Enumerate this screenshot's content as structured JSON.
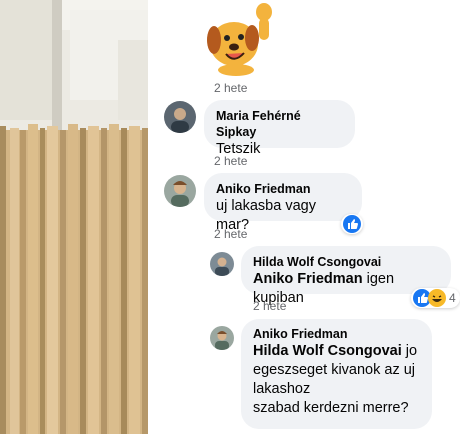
{
  "sticker": {
    "icon": "waving-dog-sticker-icon",
    "time": "2 hete"
  },
  "comments": [
    {
      "author": "Maria Fehérné Sipkay",
      "text": "Tetszik",
      "time": "2 hete"
    },
    {
      "author": "Aniko Friedman",
      "text": "uj lakasba vagy mar?",
      "time": "2 hete",
      "reaction": "like-icon"
    }
  ],
  "replies": [
    {
      "author": "Hilda Wolf Csongovai",
      "mention": "Aniko Friedman",
      "text": " igen kupiban",
      "time": "2 hete",
      "reactions": [
        "like-icon",
        "haha-icon"
      ],
      "reaction_count": "4"
    },
    {
      "author": "Aniko Friedman",
      "mention": "Hilda Wolf Csongovai",
      "text_line1": " jo",
      "text_line2": "egeszseget kivanok az uj",
      "text_line3": "lakashoz",
      "text_line4": "szabad kerdezni merre?"
    }
  ],
  "colors": {
    "bubble": "#f0f2f5",
    "meta": "#65676b",
    "like": "#1877f2",
    "haha": "#f7b928"
  }
}
